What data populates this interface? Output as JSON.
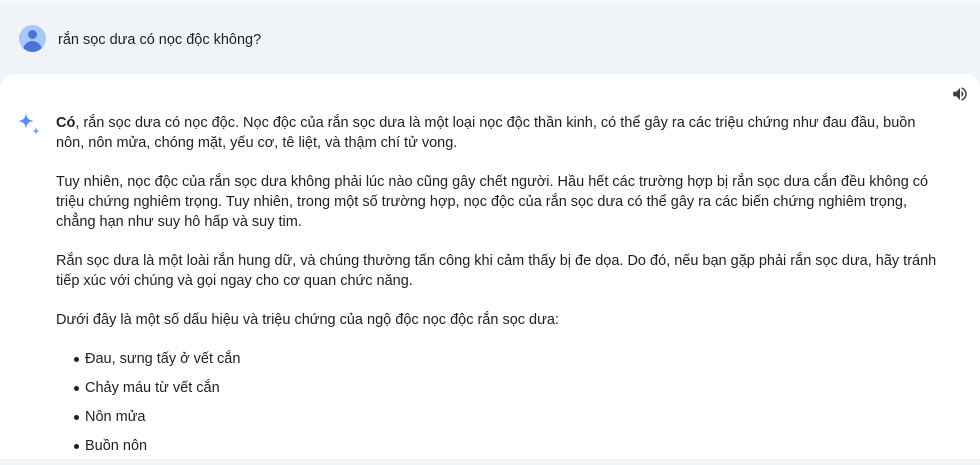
{
  "query": {
    "text": "rắn sọc dưa có nọc độc không?"
  },
  "response": {
    "intro_bold": "Có",
    "intro_rest": ", rắn sọc dưa có nọc độc. Nọc độc của rắn sọc dưa là một loại nọc độc thần kinh, có thể gây ra các triệu chứng như đau đầu, buồn nôn, nôn mửa, chóng mặt, yếu cơ, tê liệt, và thậm chí tử vong.",
    "paragraph_2": "Tuy nhiên, nọc độc của rắn sọc dưa không phải lúc nào cũng gây chết người. Hầu hết các trường hợp bị rắn sọc dưa cắn đều không có triệu chứng nghiêm trọng. Tuy nhiên, trong một số trường hợp, nọc độc của rắn sọc dưa có thể gây ra các biến chứng nghiêm trọng, chẳng hạn như suy hô hấp và suy tim.",
    "paragraph_3": "Rắn sọc dưa là một loài rắn hung dữ, và chúng thường tấn công khi cảm thấy bị đe dọa. Do đó, nếu bạn gặp phải rắn sọc dưa, hãy tránh tiếp xúc với chúng và gọi ngay cho cơ quan chức năng.",
    "paragraph_4": "Dưới đây là một số dấu hiệu và triệu chứng của ngộ độc nọc độc rắn sọc dưa:",
    "symptoms": [
      "Đau, sưng tấy ở vết cắn",
      "Chảy máu từ vết cắn",
      "Nôn mửa",
      "Buồn nôn"
    ]
  },
  "icons": {
    "avatar": "user-avatar-icon",
    "sparkle": "gemini-sparkle-icon",
    "speaker": "speaker-volume-icon"
  },
  "colors": {
    "background": "#f0f4f9",
    "card": "#ffffff",
    "avatar": "#a8c7fa",
    "avatar_figure": "#4a74d6",
    "sparkle": "#5b8def",
    "text": "#1f1f1f"
  }
}
